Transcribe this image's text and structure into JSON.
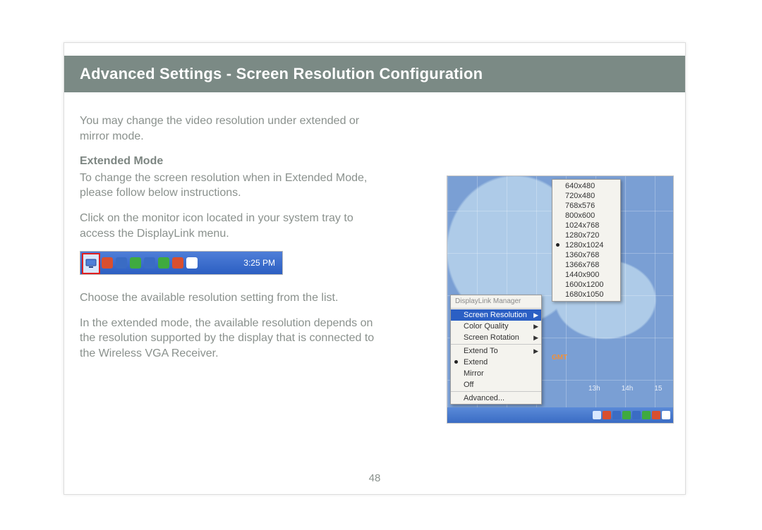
{
  "header": {
    "title": "Advanced Settings - Screen Resolution Configuration"
  },
  "body": {
    "intro": "You may change the video resolution under extended or mirror mode.",
    "section_heading": "Extended Mode",
    "p1": "To change the screen resolution when in Extended Mode, please follow below instructions.",
    "p2": "Click on the monitor icon located in your system tray to access the DisplayLink menu.",
    "p3": "Choose the available resolution setting from the list.",
    "p4": "In the extended mode, the available resolution depends on the resolution supported by the display that is connected to the Wireless VGA Receiver."
  },
  "tray": {
    "time": "3:25 PM",
    "icon_colors": [
      "#d94f2f",
      "#3a6cc4",
      "#3faa3f",
      "#3a6cc4",
      "#3faa3f",
      "#d94f2f",
      "#ffffff"
    ]
  },
  "context_menu": {
    "title": "DisplayLink Manager",
    "items": [
      {
        "label": "Screen Resolution",
        "selected": true,
        "submenu": true
      },
      {
        "label": "Color Quality",
        "submenu": true
      },
      {
        "label": "Screen Rotation",
        "submenu": true
      }
    ],
    "group2": [
      {
        "label": "Extend To",
        "submenu": true
      },
      {
        "label": "Extend",
        "checked": true
      },
      {
        "label": "Mirror"
      },
      {
        "label": "Off"
      }
    ],
    "group3": [
      {
        "label": "Advanced..."
      }
    ]
  },
  "resolutions": {
    "items": [
      "640x480",
      "720x480",
      "768x576",
      "800x600",
      "1024x768",
      "1280x720",
      "1280x1024",
      "1360x768",
      "1366x768",
      "1440x900",
      "1600x1200",
      "1680x1050"
    ],
    "selected": "1280x1024"
  },
  "map": {
    "gmt_label": "GMT",
    "hours": [
      "13h",
      "14h",
      "15"
    ]
  },
  "page_number": "48"
}
